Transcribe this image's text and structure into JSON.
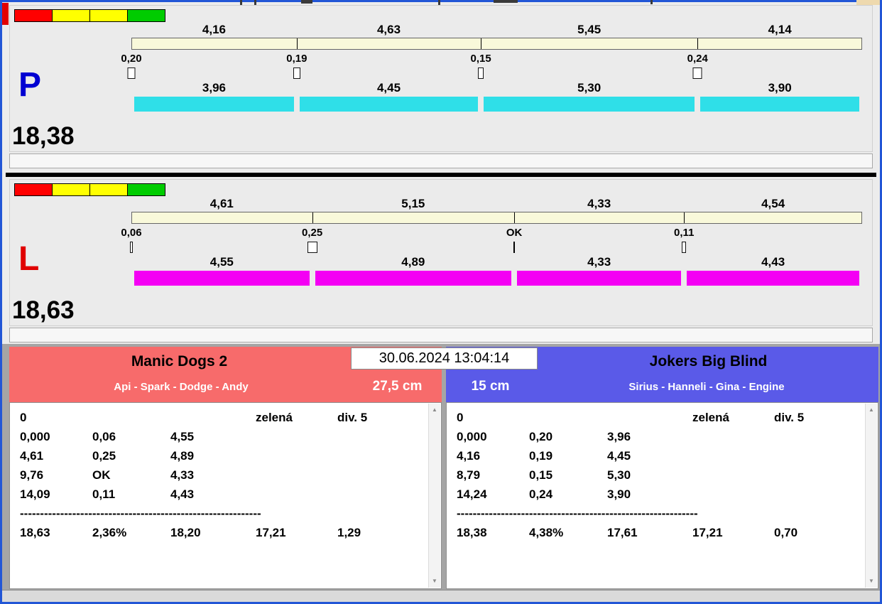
{
  "window": {
    "frame_color": "#2256d6",
    "background": "#ececec",
    "timestamp": "30.06.2024 13:04:14"
  },
  "colors": {
    "scale_bar": "#f9f9da"
  },
  "legend_colors": [
    "#ff0000",
    "#ffff00",
    "#ffff00",
    "#00cc00"
  ],
  "lanes": [
    {
      "label": "P",
      "label_color": "#0000d2",
      "bar_color": "#2fdfe8",
      "total": "18,38",
      "segments": [
        {
          "value": 4.16,
          "top": "4,16",
          "change": "0,20",
          "bottom": "3,96"
        },
        {
          "value": 4.63,
          "top": "4,63",
          "change": "0,19",
          "bottom": "4,45"
        },
        {
          "value": 5.45,
          "top": "5,45",
          "change": "0,15",
          "bottom": "5,30"
        },
        {
          "value": 4.14,
          "top": "4,14",
          "change": "0,24",
          "bottom": "3,90"
        }
      ]
    },
    {
      "label": "L",
      "label_color": "#e00000",
      "bar_color": "#f400f4",
      "total": "18,63",
      "segments": [
        {
          "value": 4.61,
          "top": "4,61",
          "change": "0,06",
          "bottom": "4,55"
        },
        {
          "value": 5.15,
          "top": "5,15",
          "change": "0,25",
          "bottom": "4,89"
        },
        {
          "value": 4.33,
          "top": "4,33",
          "change": "OK",
          "bottom": "4,33"
        },
        {
          "value": 4.54,
          "top": "4,54",
          "change": "0,11",
          "bottom": "4,43"
        }
      ]
    }
  ],
  "teams": [
    {
      "name": "Manic Dogs 2",
      "members": "Api - Spark - Dodge - Andy",
      "jump_height": "27,5 cm",
      "header_color": "#f76b6b",
      "head": {
        "zero": "0",
        "light": "zelená",
        "division": "div. 5"
      },
      "rows": [
        [
          "0,000",
          "0,06",
          "4,55"
        ],
        [
          "4,61",
          "0,25",
          "4,89"
        ],
        [
          "9,76",
          "OK",
          "4,33"
        ],
        [
          "14,09",
          "0,11",
          "4,43"
        ]
      ],
      "separator": "------------------------------------------------------------",
      "totals": [
        "18,63",
        "2,36%",
        "18,20",
        "17,21",
        "1,29"
      ]
    },
    {
      "name": "Jokers Big Blind",
      "members": "Sirius - Hanneli - Gina - Engine",
      "jump_height": "15 cm",
      "header_color": "#5a5ae8",
      "head": {
        "zero": "0",
        "light": "zelená",
        "division": "div. 5"
      },
      "rows": [
        [
          "0,000",
          "0,20",
          "3,96"
        ],
        [
          "4,16",
          "0,19",
          "4,45"
        ],
        [
          "8,79",
          "0,15",
          "5,30"
        ],
        [
          "14,24",
          "0,24",
          "3,90"
        ]
      ],
      "separator": "------------------------------------------------------------",
      "totals": [
        "18,38",
        "4,38%",
        "17,61",
        "17,21",
        "0,70"
      ]
    }
  ]
}
